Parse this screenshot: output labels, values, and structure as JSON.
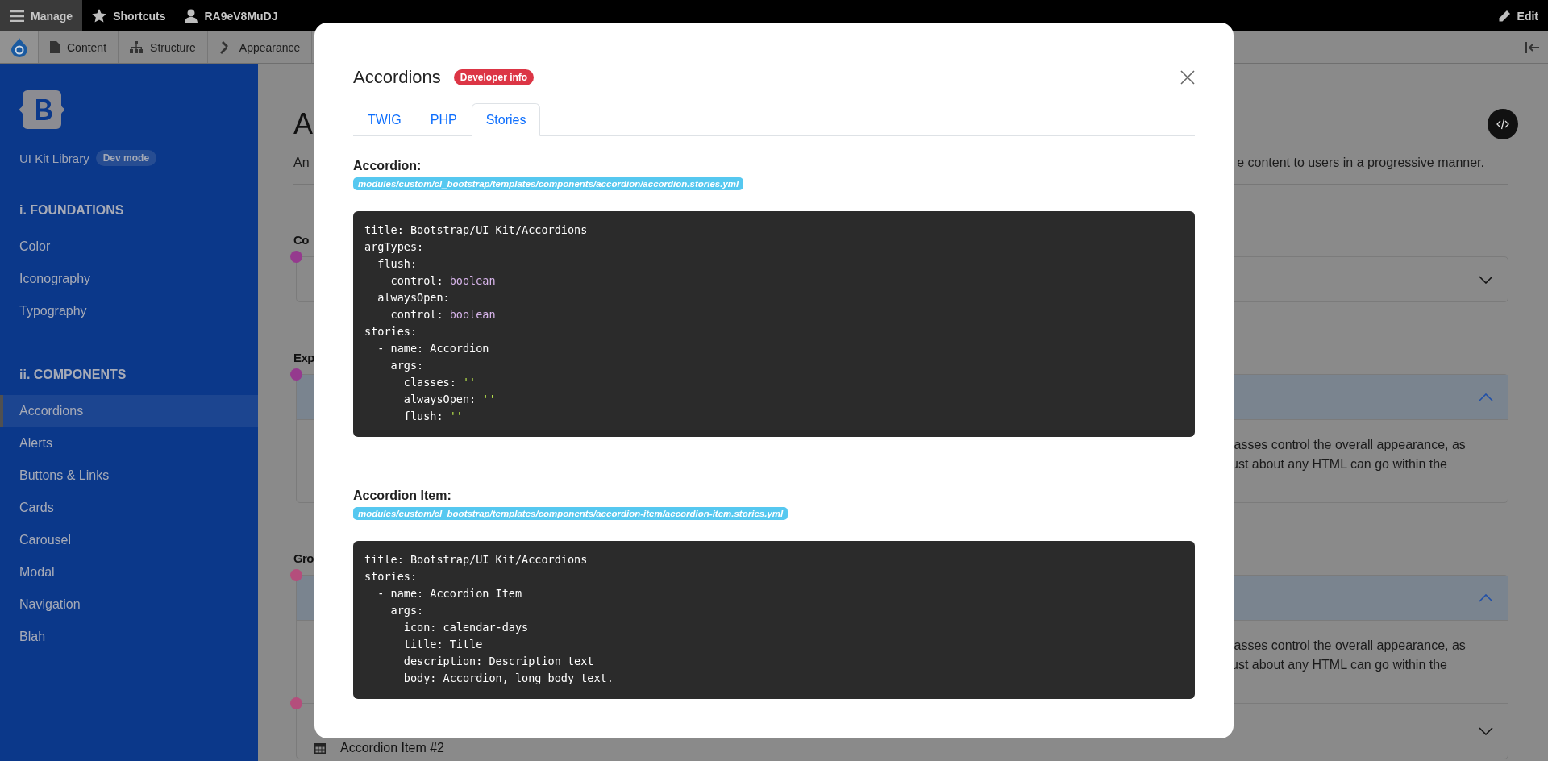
{
  "toolbar": {
    "items": [
      {
        "label": "Manage",
        "selected": true
      },
      {
        "label": "Shortcuts",
        "selected": false
      },
      {
        "label": "RA9eV8MuDJ",
        "selected": false
      }
    ],
    "edit": "Edit"
  },
  "admin_menu": {
    "items": [
      "Content",
      "Structure",
      "Appearance"
    ]
  },
  "sidebar": {
    "brand": "UI Kit Library",
    "badge": "Dev mode",
    "sections": [
      {
        "title": "i. FOUNDATIONS",
        "items": [
          {
            "label": "Color",
            "selected": false
          },
          {
            "label": "Iconography",
            "selected": false
          },
          {
            "label": "Typography",
            "selected": false
          }
        ]
      },
      {
        "title": "ii. COMPONENTS",
        "items": [
          {
            "label": "Accordions",
            "selected": true
          },
          {
            "label": "Alerts",
            "selected": false
          },
          {
            "label": "Buttons & Links",
            "selected": false
          },
          {
            "label": "Cards",
            "selected": false
          },
          {
            "label": "Carousel",
            "selected": false
          },
          {
            "label": "Modal",
            "selected": false
          },
          {
            "label": "Navigation",
            "selected": false
          },
          {
            "label": "Blah",
            "selected": false
          }
        ]
      }
    ]
  },
  "page": {
    "title": "A",
    "lead_start": "An",
    "lead_end": "e content to users in a progressive manner.",
    "sections": [
      {
        "heading": "Co",
        "items": [
          {
            "expanded": false
          }
        ]
      },
      {
        "heading": "Exp",
        "items": [
          {
            "expanded": true,
            "body": [
              "lasses control the overall appearance, as",
              "ust about any HTML can go within the"
            ]
          }
        ]
      },
      {
        "heading": "Gro",
        "items": [
          {
            "expanded": true,
            "body": [
              "lasses control the overall appearance, as",
              "ust about any HTML can go within the"
            ]
          },
          {
            "expanded": false,
            "title": "Accordion Item #2"
          }
        ]
      }
    ]
  },
  "modal": {
    "title": "Accordions",
    "badge": "Developer info",
    "tabs": [
      {
        "label": "TWIG",
        "selected": false
      },
      {
        "label": "PHP",
        "selected": false
      },
      {
        "label": "Stories",
        "selected": true
      }
    ],
    "blocks": [
      {
        "label": "Accordion:",
        "path": "modules/custom/cl_bootstrap/templates/components/accordion/accordion.stories.yml",
        "lines": [
          {
            "code": "title: Bootstrap/UI Kit/Accordions"
          },
          {
            "code": "argTypes:"
          },
          {
            "code": "  flush:"
          },
          {
            "code": "    control: ",
            "value": "boolean",
            "kind": "keyword"
          },
          {
            "code": "  alwaysOpen:"
          },
          {
            "code": "    control: ",
            "value": "boolean",
            "kind": "keyword"
          },
          {
            "code": "stories:"
          },
          {
            "code": "  - name: Accordion"
          },
          {
            "code": "    args:"
          },
          {
            "code": "      classes: ",
            "value": "''",
            "kind": "string"
          },
          {
            "code": "      alwaysOpen: ",
            "value": "''",
            "kind": "string"
          },
          {
            "code": "      flush: ",
            "value": "''",
            "kind": "string"
          }
        ]
      },
      {
        "label": "Accordion Item:",
        "path": "modules/custom/cl_bootstrap/templates/components/accordion-item/accordion-item.stories.yml",
        "lines": [
          {
            "code": "title: Bootstrap/UI Kit/Accordions"
          },
          {
            "code": "stories:"
          },
          {
            "code": "  - name: Accordion Item"
          },
          {
            "code": "    args:"
          },
          {
            "code": "      icon: calendar-days"
          },
          {
            "code": "      title: Title"
          },
          {
            "code": "      description: Description text"
          },
          {
            "code": "      body: Accordion, long body text."
          }
        ]
      }
    ]
  }
}
